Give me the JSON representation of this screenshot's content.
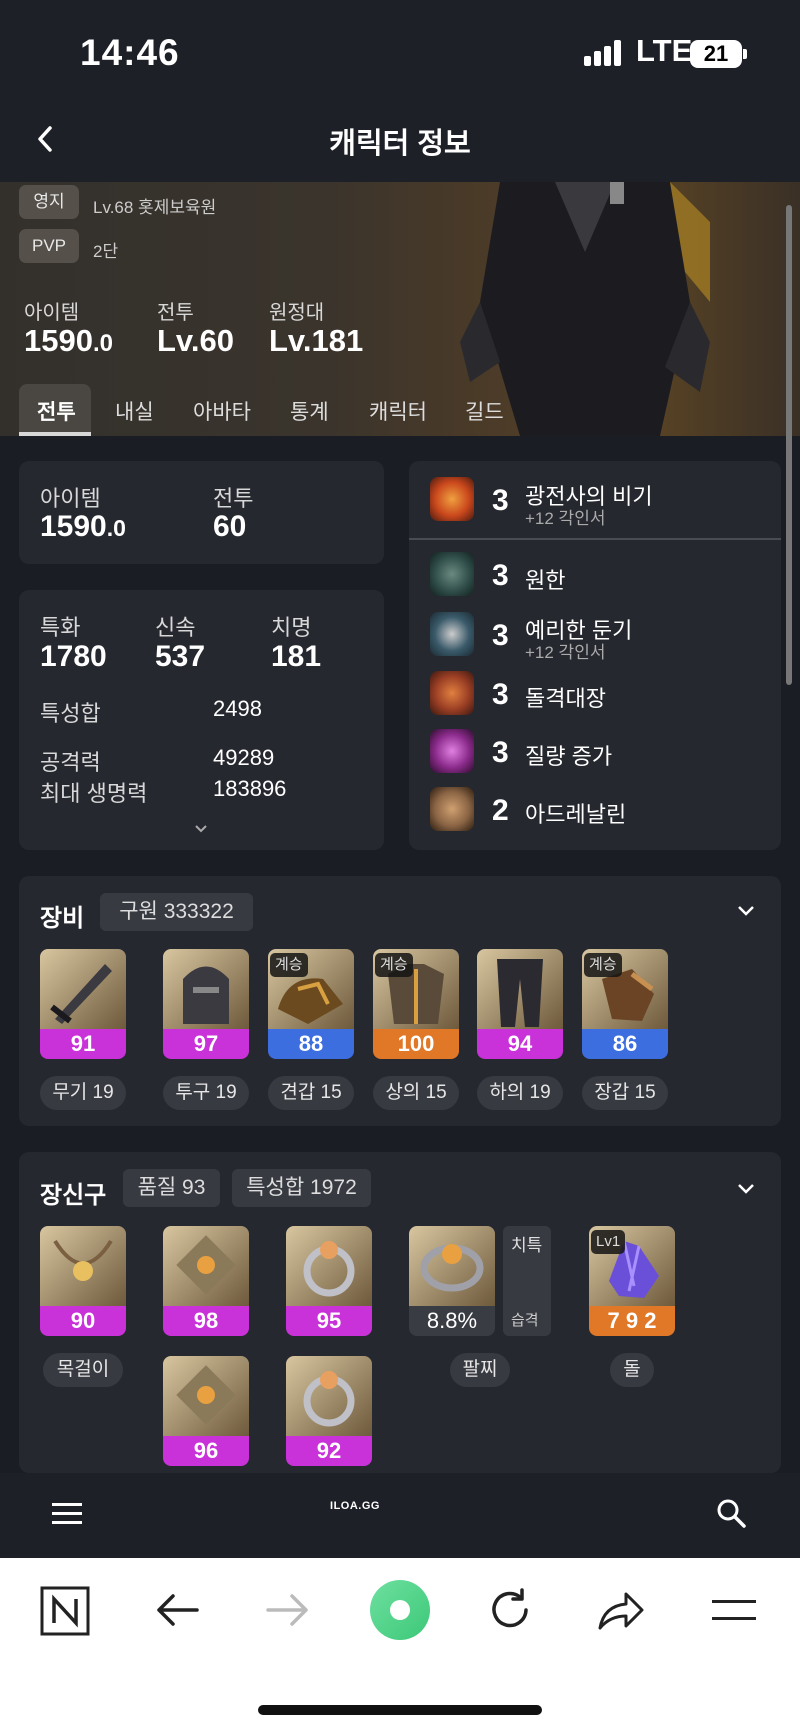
{
  "status_bar": {
    "time": "14:46",
    "network": "LTE",
    "battery": "21"
  },
  "header": {
    "title": "캐릭터 정보"
  },
  "profile": {
    "tags": [
      {
        "label": "영지",
        "value": "Lv.68 홋제보육원"
      },
      {
        "label": "PVP",
        "value": "2단"
      }
    ],
    "stats": [
      {
        "label": "아이템",
        "value": "1590",
        "decimal": ".0"
      },
      {
        "label": "전투",
        "value": "Lv.60"
      },
      {
        "label": "원정대",
        "value": "Lv.181"
      }
    ]
  },
  "tabs": [
    "전투",
    "내실",
    "아바타",
    "통계",
    "캐릭터",
    "길드"
  ],
  "summary": {
    "item_label": "아이템",
    "item_value": "1590",
    "item_decimal": ".0",
    "combat_label": "전투",
    "combat_value": "60"
  },
  "combat_stats": {
    "top": [
      {
        "label": "특화",
        "value": "1780"
      },
      {
        "label": "신속",
        "value": "537"
      },
      {
        "label": "치명",
        "value": "181"
      }
    ],
    "total_label": "특성합",
    "total_value": "2498",
    "attack_label": "공격력",
    "attack_value": "49289",
    "hp_label": "최대 생명력",
    "hp_value": "183896"
  },
  "engravings": [
    {
      "level": "3",
      "name": "광전사의 비기",
      "sub": "+12 각인서",
      "icon": "berserker-icon",
      "color": "#c9471c"
    },
    {
      "level": "3",
      "name": "원한",
      "sub": "",
      "icon": "grudge-icon",
      "color": "#2d4a46"
    },
    {
      "level": "3",
      "name": "예리한 둔기",
      "sub": "+12 각인서",
      "icon": "blunt-icon",
      "color": "#3a5a6a"
    },
    {
      "level": "3",
      "name": "돌격대장",
      "sub": "",
      "icon": "raid-captain-icon",
      "color": "#9a3e24"
    },
    {
      "level": "3",
      "name": "질량 증가",
      "sub": "",
      "icon": "mass-increase-icon",
      "color": "#8a2a8a"
    },
    {
      "level": "2",
      "name": "아드레날린",
      "sub": "",
      "icon": "adrenaline-icon",
      "color": "#8a6444"
    }
  ],
  "equipment": {
    "title": "장비",
    "chip": "구원 333322",
    "items": [
      {
        "quality": "91",
        "label": "무기 19",
        "badge": "",
        "bar_color": "#c832d8",
        "icon": "weapon-icon"
      },
      {
        "quality": "97",
        "label": "투구 19",
        "badge": "",
        "bar_color": "#c832d8",
        "icon": "helmet-icon"
      },
      {
        "quality": "88",
        "label": "견갑 15",
        "badge": "계승",
        "bar_color": "#3c6ee0",
        "icon": "shoulder-icon"
      },
      {
        "quality": "100",
        "label": "상의 15",
        "badge": "계승",
        "bar_color": "#e07828",
        "icon": "chest-icon"
      },
      {
        "quality": "94",
        "label": "하의 19",
        "badge": "",
        "bar_color": "#c832d8",
        "icon": "pants-icon"
      },
      {
        "quality": "86",
        "label": "장갑 15",
        "badge": "계승",
        "bar_color": "#3c6ee0",
        "icon": "gloves-icon"
      }
    ]
  },
  "accessories": {
    "title": "장신구",
    "chip1": "품질 93",
    "chip2": "특성합 1972",
    "necklace": {
      "quality": "90",
      "label": "목걸이"
    },
    "earrings": [
      {
        "quality": "98"
      },
      {
        "quality": "96"
      }
    ],
    "rings": [
      {
        "quality": "95"
      },
      {
        "quality": "92"
      }
    ],
    "bracelet": {
      "value": "8.8%",
      "label": "팔찌",
      "stat1": "치특",
      "stat2": "습격"
    },
    "stone": {
      "badge": "Lv1",
      "value": "7 9 2",
      "label": "돌"
    }
  },
  "bottom_bar": {
    "logo": "ILOA.GG"
  }
}
